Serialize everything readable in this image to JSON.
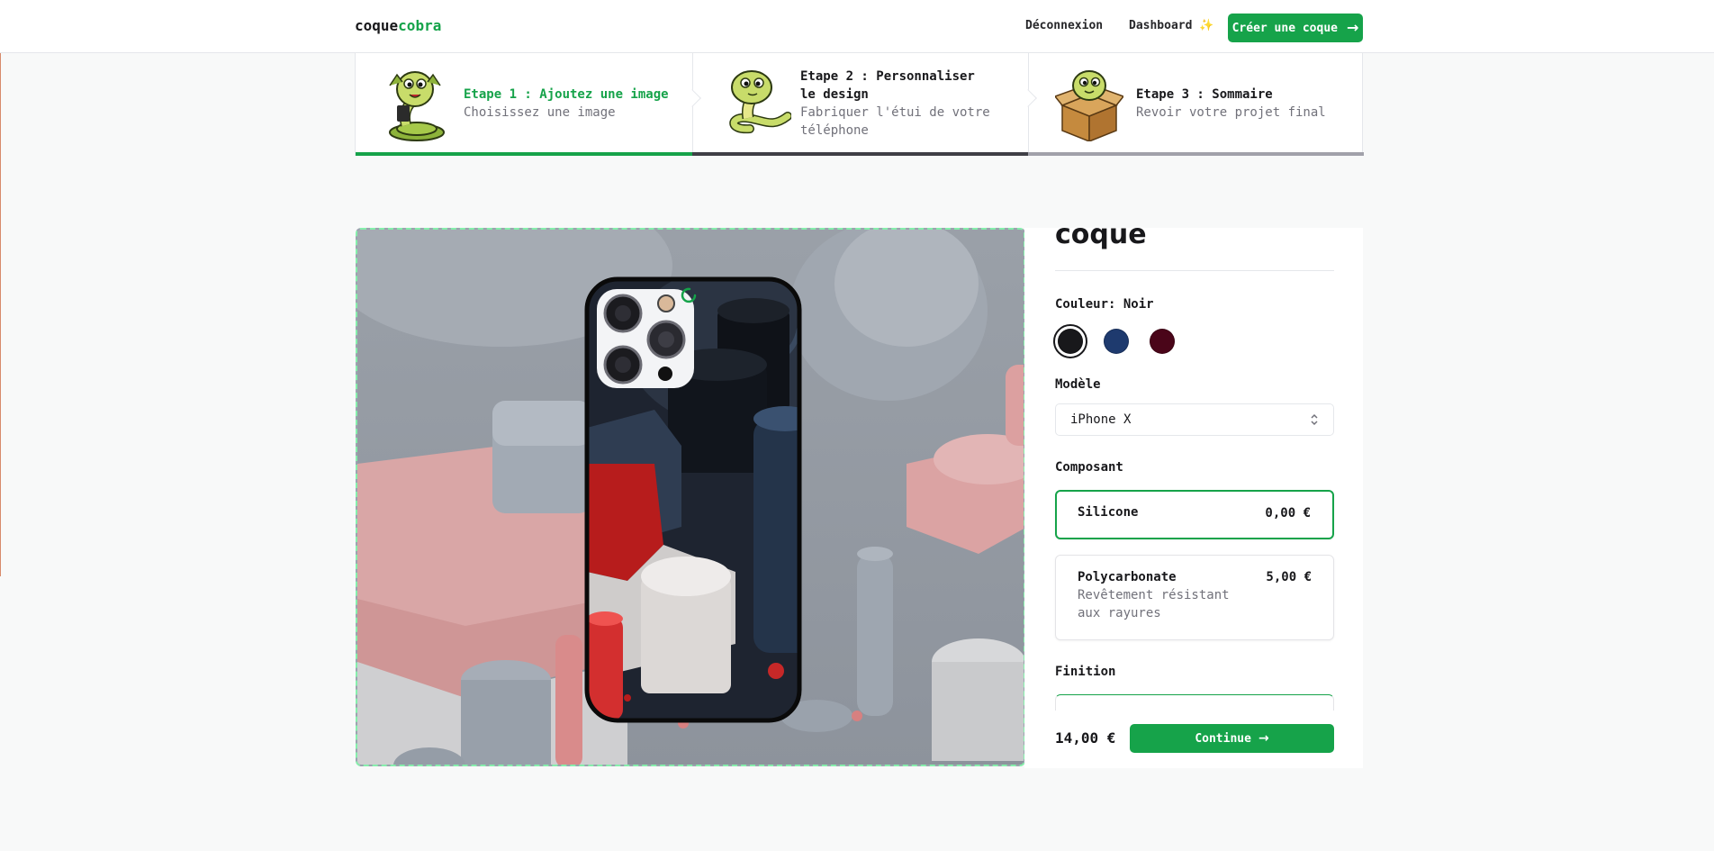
{
  "navbar": {
    "logo_part1": "coque",
    "logo_part2": "cobra",
    "logout": "Déconnexion",
    "dashboard": "Dashboard ✨",
    "cta": "Créer une coque"
  },
  "steps": [
    {
      "title": "Etape 1 : Ajoutez une image",
      "subtitle": "Choisissez une image",
      "status": "complete"
    },
    {
      "title": "Etape 2 : Personnaliser le design",
      "subtitle": "Fabriquer l'étui de votre téléphone",
      "status": "current"
    },
    {
      "title": "Etape 3 : Sommaire",
      "subtitle": "Revoir votre projet final",
      "status": "upcoming"
    }
  ],
  "panel": {
    "heading": "coque",
    "color_label": "Couleur: Noir",
    "colors": [
      {
        "name": "Noir",
        "hex": "#18181b",
        "selected": true
      },
      {
        "name": "Bleu",
        "hex": "#1e3a6e",
        "selected": false
      },
      {
        "name": "Bordeaux",
        "hex": "#4a0519",
        "selected": false
      }
    ],
    "model_label": "Modèle",
    "model_value": "iPhone X",
    "material_label": "Composant",
    "materials": [
      {
        "name": "Silicone",
        "price": "0,00 €",
        "selected": true
      },
      {
        "name": "Polycarbonate",
        "price": "5,00 €",
        "description": "Revêtement résistant aux rayures",
        "selected": false
      }
    ],
    "finish_label": "Finition",
    "total": "14,00 €",
    "continue": "Continue"
  },
  "colors": {
    "accent": "#16a34a",
    "step_current": "#3f3f46",
    "step_upcoming": "#a1a1aa"
  }
}
